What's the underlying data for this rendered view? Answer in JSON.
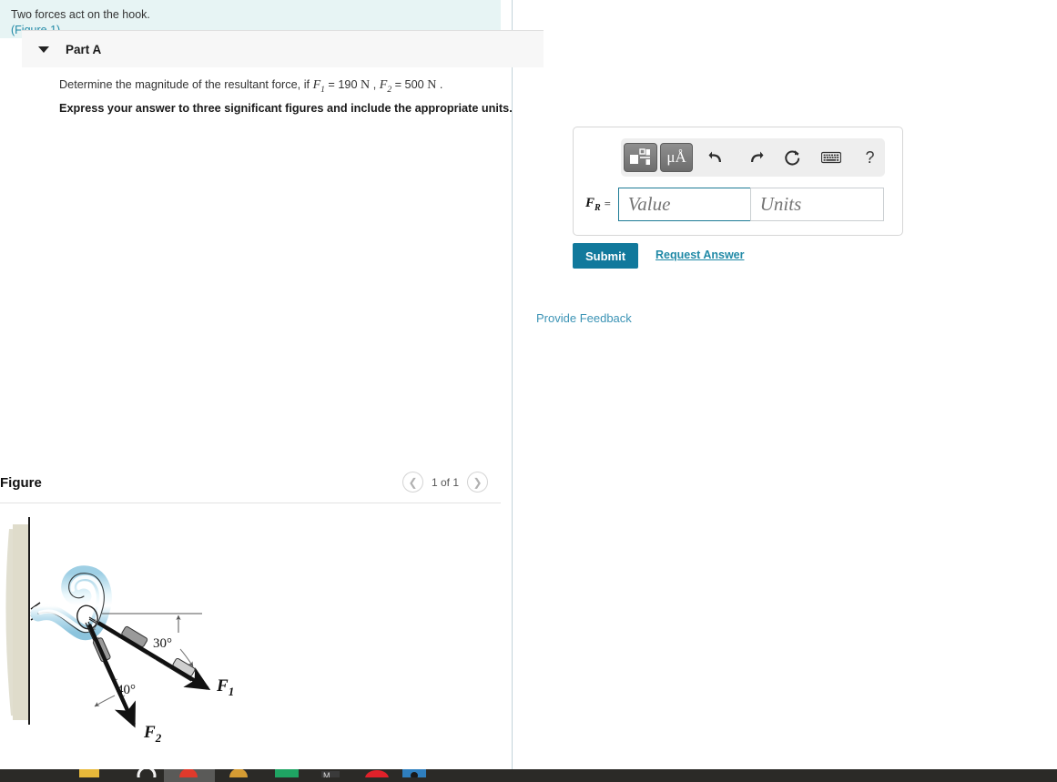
{
  "problem": {
    "statement": "Two forces act on the hook.",
    "figure_link": "(Figure 1)"
  },
  "figure_panel": {
    "title": "Figure",
    "counter": "1 of 1",
    "prev_icon": "chevron-left-icon",
    "next_icon": "chevron-right-icon"
  },
  "figure_diagram": {
    "type": "free-body-diagram",
    "description": "A hook bolted to a vertical wall with two cables pulling on it",
    "wall_color": "#d8d6c4",
    "hook_color": "#a9d6ea",
    "labels": {
      "angle_1": "30°",
      "angle_2": "40°",
      "force_1": "F",
      "force_1_sub": "1",
      "force_2": "F",
      "force_2_sub": "2"
    },
    "geometry": {
      "f1_angle_below_horizontal_deg": 30,
      "f2_angle_from_f1_deg": 40,
      "reference_line": "horizontal dashed reference from hook"
    }
  },
  "part": {
    "title": "Part A",
    "caret_icon": "caret-down-icon",
    "question_prefix": "Determine the magnitude of the resultant force, if ",
    "var_f1": "F",
    "var_f1_sub": "1",
    "eq_1": " = 190 ",
    "unit_1": "N",
    "comma": " , ",
    "var_f2": "F",
    "var_f2_sub": "2",
    "eq_2": " = 500 ",
    "unit_2": "N",
    "period": " .",
    "instruction": "Express your answer to three significant figures and include the appropriate units."
  },
  "answer_widget": {
    "toolbar": {
      "template_icon": "math-template-icon",
      "units_icon": "micro-angstrom-units-icon",
      "units_label": "μÅ",
      "undo_icon": "undo-arrow-icon",
      "undo_label": "↶",
      "redo_icon": "redo-arrow-icon",
      "redo_label": "↷",
      "reset_icon": "reset-circular-arrow-icon",
      "reset_label": "↻",
      "keyboard_icon": "keyboard-icon",
      "help_icon": "question-mark-help-icon",
      "help_label": "?"
    },
    "field_label": "F",
    "field_label_sub": "R",
    "equals": "=",
    "value_placeholder": "Value",
    "units_placeholder": "Units",
    "value_current": "",
    "units_current": ""
  },
  "actions": {
    "submit_label": "Submit",
    "request_answer_label": "Request Answer",
    "provide_feedback_label": "Provide Feedback"
  },
  "colors": {
    "accent_teal": "#11799c",
    "link_blue": "#2089a6",
    "info_bg": "#e7f4f4",
    "header_bg": "#f7f7f7"
  },
  "taskbar": {
    "present": true,
    "background": "#2b2a27",
    "icons": [
      "folder-icon",
      "settings-gear-icon",
      "browser-icon",
      "firefox-icon",
      "spreadsheet-icon",
      "editor-icon",
      "redhat-icon",
      "media-icon"
    ]
  }
}
